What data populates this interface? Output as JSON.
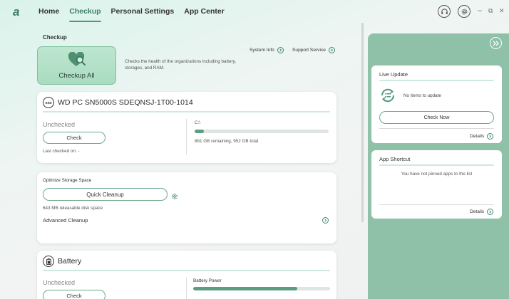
{
  "nav": {
    "logo": "a",
    "items": [
      "Home",
      "Checkup",
      "Personal Settings",
      "App Center"
    ],
    "active": "Checkup"
  },
  "window": {
    "min": "–",
    "restore": "⧉",
    "close": "✕"
  },
  "checkup": {
    "section_title": "Checkup",
    "checkup_all_label": "Checkup All",
    "description": "Checks the health of the organizations including battery, storages, and RAM.",
    "system_info": "System Info",
    "support_service": "Support Service"
  },
  "drive": {
    "name": "WD PC SN5000S SDEQNSJ-1T00-1014",
    "badge": "SSD",
    "status": "Unchecked",
    "check_label": "Check",
    "last_checked": "Last checked on: -",
    "volume": "C:\\",
    "usage_fraction": 0.07,
    "space_text": "881 GB remaining, 952 GB total"
  },
  "storage": {
    "title": "Optimize Storage Space",
    "quick_cleanup": "Quick Cleanup",
    "releasable": "643 MB releasable disk space",
    "advanced": "Advanced Cleanup"
  },
  "battery": {
    "title": "Battery",
    "status": "Unchecked",
    "check_label": "Check",
    "power_label": "Battery Power",
    "power_fraction": 0.76
  },
  "live_update": {
    "title": "Live Update",
    "message": "No items to update",
    "check_now": "Check Now",
    "details": "Details"
  },
  "app_shortcut": {
    "title": "App Shortcut",
    "message": "You have not pinned apps to the list",
    "details": "Details"
  },
  "colors": {
    "accent": "#4f9a7c",
    "panel": "#8fc1a9",
    "tile": "#a9dcc0"
  }
}
